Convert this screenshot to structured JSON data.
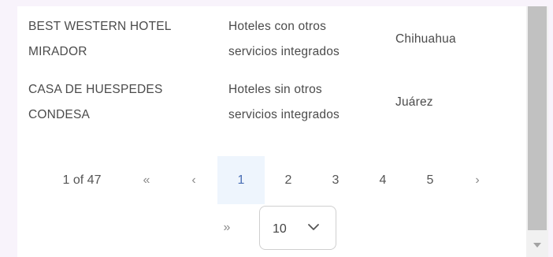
{
  "rows": [
    {
      "name_lines": [
        "BEST WESTERN HOTEL",
        "MIRADOR"
      ],
      "category_lines": [
        "Hoteles con otros",
        "servicios integrados"
      ],
      "city": "Chihuahua"
    },
    {
      "name_lines": [
        "CASA DE HUESPEDES",
        "CONDESA"
      ],
      "category_lines": [
        "Hoteles sin otros",
        "servicios integrados"
      ],
      "city": "Juárez"
    }
  ],
  "pagination": {
    "page_info": "1 of 47",
    "first": "«",
    "prev": "‹",
    "pages": [
      "1",
      "2",
      "3",
      "4",
      "5"
    ],
    "next": "›",
    "last": "»",
    "page_size": "10"
  },
  "icons": {
    "first": "double-chevron-left-icon",
    "prev": "chevron-left-icon",
    "next": "chevron-right-icon",
    "last": "double-chevron-right-icon",
    "select": "chevron-down-icon"
  }
}
